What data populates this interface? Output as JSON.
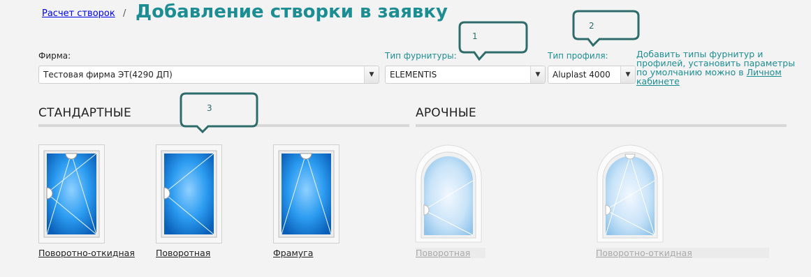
{
  "breadcrumb": {
    "link": "Расчет створок",
    "separator": "/"
  },
  "page_title": "Добавление створки в заявку",
  "fields": {
    "firm": {
      "label": "Фирма:",
      "value": "Тестовая фирма ЭТ(4290 ДП)"
    },
    "fitting": {
      "label": "Тип фурнитуры:",
      "value": "ELEMENTIS"
    },
    "profile": {
      "label": "Тип профиля:",
      "value": "Aluplast 4000"
    }
  },
  "hint": {
    "text": "Добавить типы фурнитур и профилей, установить параметры по умолчанию можно в",
    "link": "Личном кабинете"
  },
  "sections": {
    "standard": "СТАНДАРТНЫЕ",
    "arched": "АРОЧНЫЕ"
  },
  "windows": {
    "standard": [
      "Поворотно-откидная",
      "Поворотная",
      "Фрамуга"
    ],
    "arched": [
      "Поворотная",
      "Поворотно-откидная"
    ]
  },
  "callouts": [
    "1",
    "2",
    "3"
  ],
  "colors": {
    "accent": "#1d8d94",
    "callout_stroke": "#2e6b6b",
    "glass": "#1e8fe0"
  }
}
